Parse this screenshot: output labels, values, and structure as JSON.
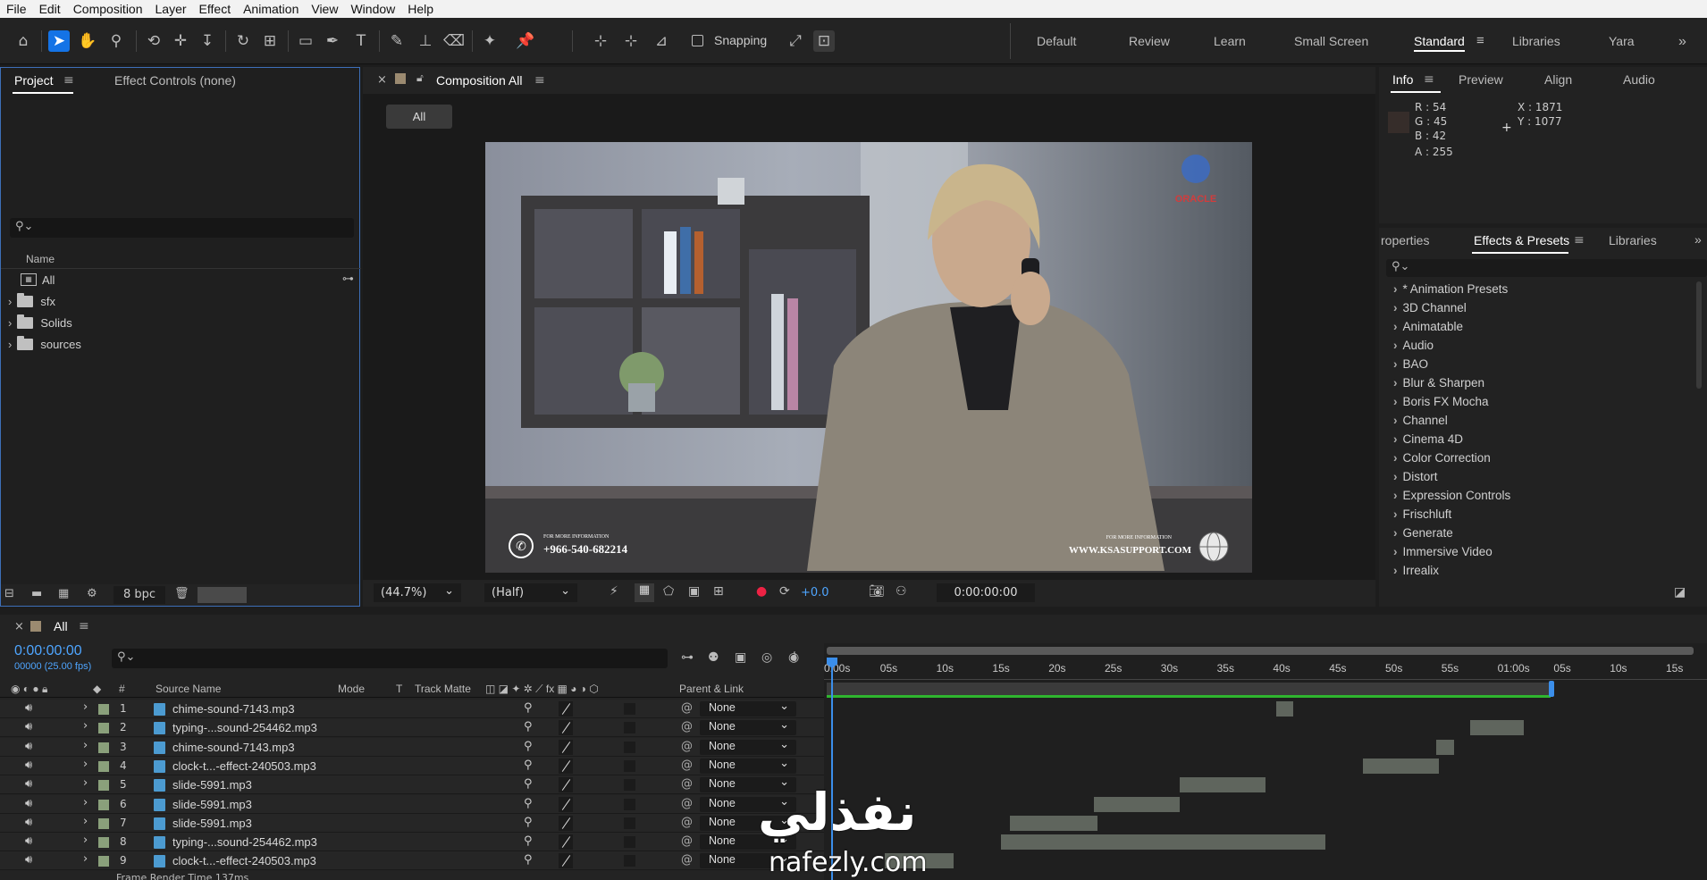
{
  "menu": [
    "File",
    "Edit",
    "Composition",
    "Layer",
    "Effect",
    "Animation",
    "View",
    "Window",
    "Help"
  ],
  "toolbar": {
    "snapping_label": "Snapping",
    "workspaces": [
      "Default",
      "Review",
      "Learn",
      "Small Screen",
      "Standard",
      "Libraries",
      "Yara"
    ],
    "active_workspace": "Standard"
  },
  "project": {
    "tab_project": "Project",
    "tab_effect_controls": "Effect Controls (none)",
    "col_name": "Name",
    "items": [
      {
        "label": "All",
        "type": "composition"
      },
      {
        "label": "sfx",
        "type": "folder"
      },
      {
        "label": "Solids",
        "type": "folder"
      },
      {
        "label": "sources",
        "type": "folder"
      }
    ],
    "bpc": "8 bpc"
  },
  "composition": {
    "tab_title": "Composition All",
    "breadcrumb": "All",
    "zoom": "(44.7%)",
    "resolution": "(Half)",
    "exposure": "+0.0",
    "timecode": "0:00:00:00",
    "overlay": {
      "logo_text": "ORACLE",
      "left_caption": "FOR MORE INFORMATION",
      "phone": "+966-540-682214",
      "right_caption": "FOR MORE INFORMATION",
      "website": "WWW.KSASUPPORT.COM"
    }
  },
  "info": {
    "tabs": [
      "Info",
      "Preview",
      "Align",
      "Audio"
    ],
    "r": "R :  54",
    "g": "G :  45",
    "b": "B :  42",
    "a": "A :  255",
    "x": "X : 1871",
    "y": "Y :  1077",
    "swatch": "#362d2a"
  },
  "effects": {
    "tabs": [
      "roperties",
      "Effects & Presets",
      "Libraries"
    ],
    "items": [
      "* Animation Presets",
      "3D Channel",
      "Animatable",
      "Audio",
      "BAO",
      "Blur & Sharpen",
      "Boris FX Mocha",
      "Channel",
      "Cinema 4D",
      "Color Correction",
      "Distort",
      "Expression Controls",
      "Frischluft",
      "Generate",
      "Immersive Video",
      "Irrealix"
    ]
  },
  "timeline": {
    "tab": "All",
    "timecode": "0:00:00:00",
    "fps": "00000 (25.00 fps)",
    "headers": {
      "num": "#",
      "source": "Source Name",
      "mode": "Mode",
      "t": "T",
      "matte": "Track Matte",
      "parent": "Parent & Link"
    },
    "ruler": [
      "0:00s",
      "05s",
      "10s",
      "15s",
      "20s",
      "25s",
      "30s",
      "35s",
      "40s",
      "45s",
      "50s",
      "55s",
      "01:00s",
      "05s",
      "10s",
      "15s"
    ],
    "layers": [
      {
        "num": "1",
        "name": "chime-sound-7143.mp3",
        "parent": "None"
      },
      {
        "num": "2",
        "name": "typing-...sound-254462.mp3",
        "parent": "None"
      },
      {
        "num": "3",
        "name": "chime-sound-7143.mp3",
        "parent": "None"
      },
      {
        "num": "4",
        "name": "clock-t...-effect-240503.mp3",
        "parent": "None"
      },
      {
        "num": "5",
        "name": "slide-5991.mp3",
        "parent": "None"
      },
      {
        "num": "6",
        "name": "slide-5991.mp3",
        "parent": "None"
      },
      {
        "num": "7",
        "name": "slide-5991.mp3",
        "parent": "None"
      },
      {
        "num": "8",
        "name": "typing-...sound-254462.mp3",
        "parent": "None"
      },
      {
        "num": "9",
        "name": "clock-t...-effect-240503.mp3",
        "parent": "None"
      }
    ],
    "status": "Frame Render Time  137ms"
  },
  "watermark": {
    "arabic": "نفذلي",
    "latin": "nafezly.com"
  },
  "colors": {
    "accent": "#1473e6",
    "timecode": "#4ea5ff",
    "work_area": "#2fb52f",
    "playhead": "#3b8eea"
  }
}
